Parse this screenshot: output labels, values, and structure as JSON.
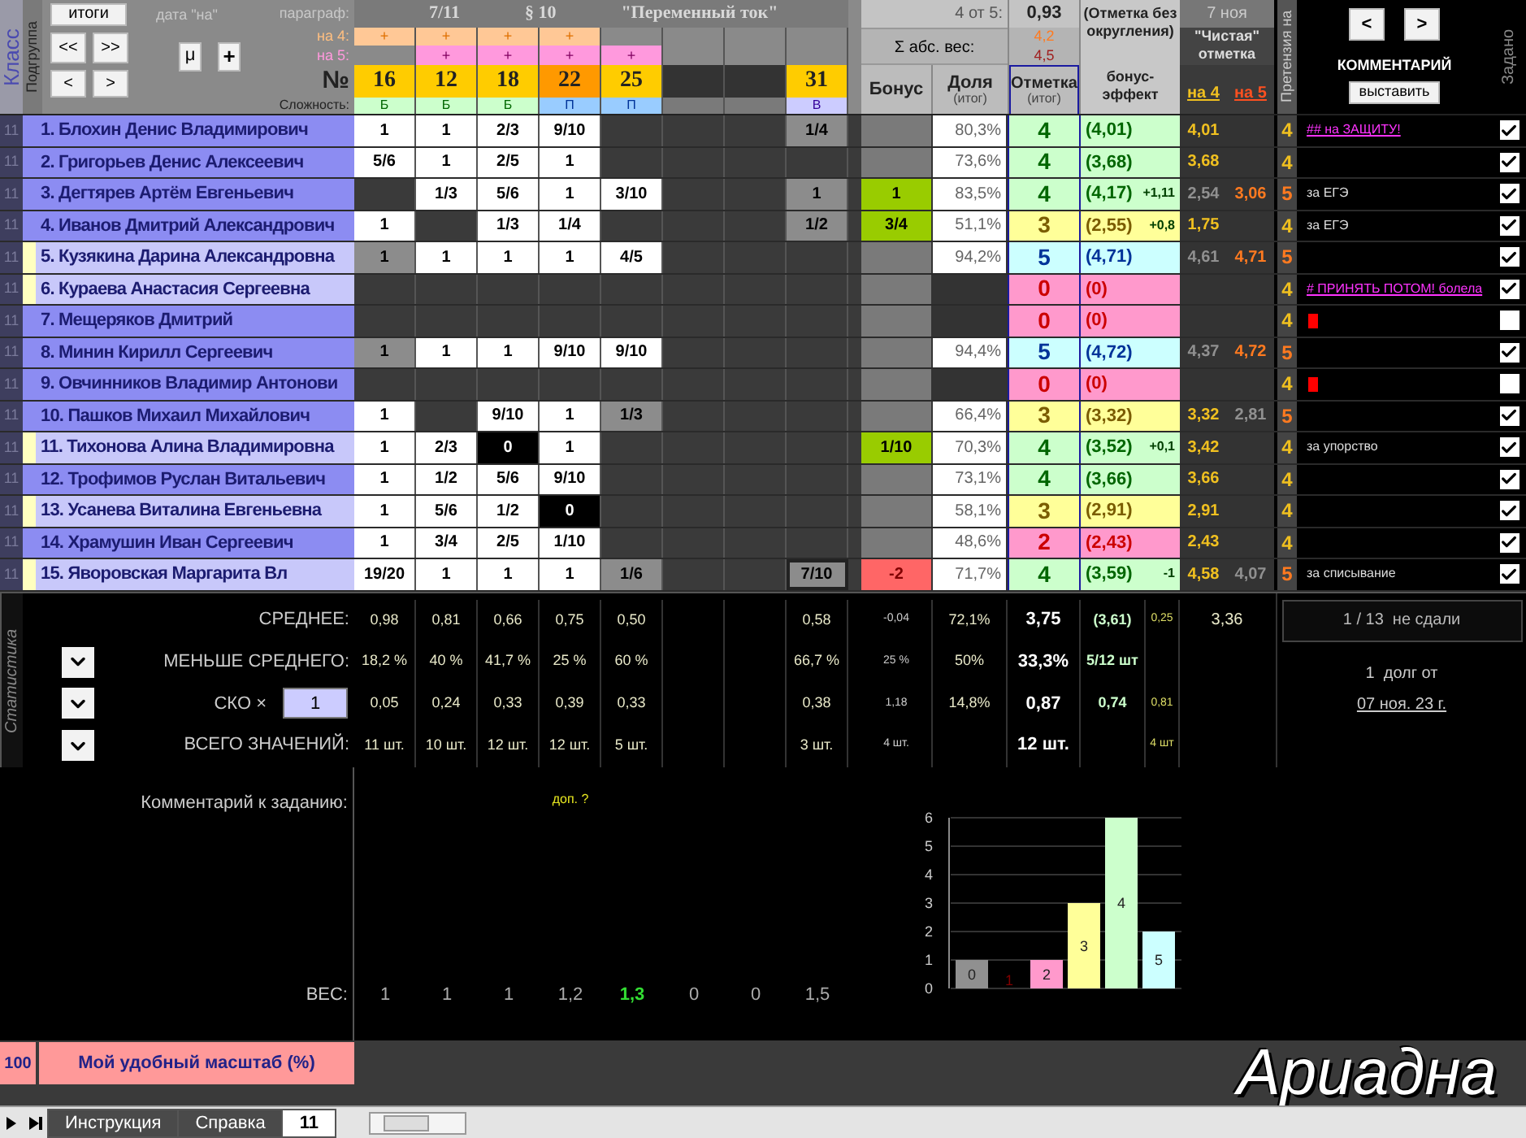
{
  "header": {
    "class_label": "Класс",
    "subgroup_label": "Подгруппа",
    "buttons": {
      "totals": "итоги",
      "first": "<<",
      "last": ">>",
      "prev": "<",
      "next": ">",
      "mu": "μ",
      "plus": "+"
    },
    "date_label": "дата \"на\"",
    "paragraph_label": "параграф:",
    "for4_label": "на 4:",
    "for5_label": "на 5:",
    "number_label": "№",
    "difficulty_label": "Сложность:",
    "lesson": "7/11",
    "paragraph": "§ 10",
    "topic": "\"Переменный ток\"",
    "tasks": [
      {
        "for4": "+",
        "number": "16",
        "highlighted": false,
        "difficulty": "Б",
        "kind": "basic"
      },
      {
        "for4": "+",
        "for5": "+",
        "number": "12",
        "highlighted": false,
        "difficulty": "Б",
        "kind": "basic"
      },
      {
        "for4": "+",
        "for5": "+",
        "number": "18",
        "highlighted": false,
        "difficulty": "Б",
        "kind": "basic"
      },
      {
        "for4": "+",
        "for5": "+",
        "number": "22",
        "highlighted": true,
        "difficulty": "П",
        "kind": "profile"
      },
      {
        "for5": "+",
        "number": "25",
        "highlighted": false,
        "difficulty": "П",
        "kind": "profile"
      },
      {
        "kind": "blank"
      },
      {
        "kind": "blank"
      },
      {
        "number": "31",
        "highlighted": false,
        "difficulty": "В",
        "kind": "advanced"
      }
    ],
    "four_of_five_label": "4 от 5:",
    "four_of_five": "0,93",
    "weight_sum_label": "Σ абс. вес:",
    "weight_for4": "4,2",
    "weight_for5": "4,5",
    "bonus_label": "Бонус",
    "share_label": "Доля",
    "share_sub": "(итог)",
    "mark_label": "Отметка",
    "mark_sub": "(итог)",
    "raw_label": "(Отметка без округления)",
    "raw_sub": "бонус-эффект",
    "date": "7 ноя",
    "clean_label": "\"Чистая\" отметка",
    "clean4_label": "на 4",
    "clean5_label": "на 5",
    "claim_label": "Претензия на",
    "comment_prev": "<",
    "comment_next": ">",
    "comment_label": "КОММЕНТАРИЙ",
    "post_button": "выставить",
    "assigned_label": "Задано"
  },
  "students": [
    {
      "class": "11",
      "girl": false,
      "name": "1. Блохин Денис Владимирович",
      "cells": [
        {
          "text": "1",
          "kind": "filled"
        },
        {
          "text": "1",
          "kind": "filled"
        },
        {
          "text": "2/3",
          "kind": "filled"
        },
        {
          "text": "9/10",
          "kind": "filled"
        },
        {
          "kind": "empty"
        },
        {
          "kind": "empty"
        },
        {
          "kind": "empty"
        },
        {
          "text": "1/4",
          "kind": "partial"
        }
      ],
      "bonus": {
        "kind": "none"
      },
      "share": "80,3%",
      "mark": {
        "text": "4",
        "kind": "good"
      },
      "raw": "(4,01)",
      "clean4": {
        "text": "4,01",
        "color": "#f0c020"
      },
      "claim": {
        "text": "4",
        "color": "#f0c020"
      },
      "comment": {
        "text": "## на ЗАЩИТУ!",
        "kind": "link"
      },
      "assigned": true
    },
    {
      "class": "11",
      "girl": false,
      "name": "2. Григорьев Денис Алексеевич",
      "cells": [
        {
          "text": "5/6",
          "kind": "filled"
        },
        {
          "text": "1",
          "kind": "filled"
        },
        {
          "text": "2/5",
          "kind": "filled"
        },
        {
          "text": "1",
          "kind": "filled"
        },
        {
          "kind": "empty"
        },
        {
          "kind": "empty"
        },
        {
          "kind": "empty"
        },
        {
          "kind": "empty"
        }
      ],
      "bonus": {
        "kind": "none"
      },
      "share": "73,6%",
      "mark": {
        "text": "4",
        "kind": "good"
      },
      "raw": "(3,68)",
      "clean4": {
        "text": "3,68",
        "color": "#f0c020"
      },
      "claim": {
        "text": "4",
        "color": "#f0c020"
      },
      "assigned": true
    },
    {
      "class": "11",
      "girl": false,
      "name": "3. Дегтярев Артём Евгеньевич",
      "cells": [
        {
          "kind": "empty"
        },
        {
          "text": "1/3",
          "kind": "filled"
        },
        {
          "text": "5/6",
          "kind": "filled"
        },
        {
          "text": "1",
          "kind": "filled"
        },
        {
          "text": "3/10",
          "kind": "filled"
        },
        {
          "kind": "empty"
        },
        {
          "kind": "empty"
        },
        {
          "text": "1",
          "kind": "partial"
        }
      ],
      "bonus": {
        "kind": "plus",
        "text": "1"
      },
      "share": "83,5%",
      "mark": {
        "text": "4",
        "kind": "good"
      },
      "raw": "(4,17)",
      "raw_extra": "+1,11",
      "clean4": {
        "text": "2,54",
        "color": "#909090"
      },
      "clean5": {
        "text": "3,06",
        "color": "#ff7a20"
      },
      "claim": {
        "text": "5",
        "color": "#ff7a20"
      },
      "comment": {
        "text": "за ЕГЭ",
        "kind": "note"
      },
      "assigned": true
    },
    {
      "class": "11",
      "girl": false,
      "name": "4. Иванов Дмитрий Александрович",
      "cells": [
        {
          "text": "1",
          "kind": "filled"
        },
        {
          "kind": "empty"
        },
        {
          "text": "1/3",
          "kind": "filled"
        },
        {
          "text": "1/4",
          "kind": "filled"
        },
        {
          "kind": "empty"
        },
        {
          "kind": "empty"
        },
        {
          "kind": "empty"
        },
        {
          "text": "1/2",
          "kind": "partial"
        }
      ],
      "bonus": {
        "kind": "plus",
        "text": "3/4"
      },
      "share": "51,1%",
      "mark": {
        "text": "3",
        "kind": "fair"
      },
      "raw": "(2,55)",
      "raw_extra": "+0,8",
      "clean4": {
        "text": "1,75",
        "color": "#f0c020"
      },
      "claim": {
        "text": "4",
        "color": "#f0c020"
      },
      "comment": {
        "text": "за ЕГЭ",
        "kind": "note"
      },
      "assigned": true
    },
    {
      "class": "11",
      "girl": true,
      "name": "5. Кузякина Дарина Александровна",
      "cells": [
        {
          "text": "1",
          "kind": "partial"
        },
        {
          "text": "1",
          "kind": "filled"
        },
        {
          "text": "1",
          "kind": "filled"
        },
        {
          "text": "1",
          "kind": "filled"
        },
        {
          "text": "4/5",
          "kind": "filled"
        },
        {
          "kind": "empty"
        },
        {
          "kind": "empty"
        },
        {
          "kind": "empty"
        }
      ],
      "bonus": {
        "kind": "none"
      },
      "share": "94,2%",
      "mark": {
        "text": "5",
        "kind": "excellent"
      },
      "raw": "(4,71)",
      "clean4": {
        "text": "4,61",
        "color": "#909090"
      },
      "clean5": {
        "text": "4,71",
        "color": "#ff7a20"
      },
      "claim": {
        "text": "5",
        "color": "#ff7a20"
      },
      "assigned": true
    },
    {
      "class": "11",
      "girl": true,
      "name": "6. Кураева Анастасия Сергеевна",
      "cells": [
        {
          "kind": "empty"
        },
        {
          "kind": "empty"
        },
        {
          "kind": "empty"
        },
        {
          "kind": "empty"
        },
        {
          "kind": "empty"
        },
        {
          "kind": "empty"
        },
        {
          "kind": "empty"
        },
        {
          "kind": "empty"
        }
      ],
      "bonus": {
        "kind": "none"
      },
      "mark": {
        "text": "0",
        "kind": "fail"
      },
      "raw": "(0)",
      "claim": {
        "text": "4",
        "color": "#f0c020"
      },
      "comment": {
        "text": "# ПРИНЯТЬ ПОТОМ! болела",
        "kind": "link"
      },
      "assigned": true
    },
    {
      "class": "11",
      "girl": false,
      "name": "7. Мещеряков Дмитрий",
      "cells": [
        {
          "kind": "empty"
        },
        {
          "kind": "empty"
        },
        {
          "kind": "empty"
        },
        {
          "kind": "empty"
        },
        {
          "kind": "empty"
        },
        {
          "kind": "empty"
        },
        {
          "kind": "empty"
        },
        {
          "kind": "empty"
        }
      ],
      "bonus": {
        "kind": "none"
      },
      "mark": {
        "text": "0",
        "kind": "fail"
      },
      "raw": "(0)",
      "claim": {
        "text": "4",
        "color": "#f0c020"
      },
      "comment": {
        "kind": "flag"
      },
      "assigned": false
    },
    {
      "class": "11",
      "girl": false,
      "name": "8. Минин Кирилл Сергеевич",
      "cells": [
        {
          "text": "1",
          "kind": "partial"
        },
        {
          "text": "1",
          "kind": "filled"
        },
        {
          "text": "1",
          "kind": "filled"
        },
        {
          "text": "9/10",
          "kind": "filled"
        },
        {
          "text": "9/10",
          "kind": "filled"
        },
        {
          "kind": "empty"
        },
        {
          "kind": "empty"
        },
        {
          "kind": "empty"
        }
      ],
      "bonus": {
        "kind": "none"
      },
      "share": "94,4%",
      "mark": {
        "text": "5",
        "kind": "excellent"
      },
      "raw": "(4,72)",
      "clean4": {
        "text": "4,37",
        "color": "#909090"
      },
      "clean5": {
        "text": "4,72",
        "color": "#ff7a20"
      },
      "claim": {
        "text": "5",
        "color": "#ff7a20"
      },
      "assigned": true
    },
    {
      "class": "11",
      "girl": false,
      "name": "9. Овчинников Владимир Антонови",
      "cells": [
        {
          "kind": "empty"
        },
        {
          "kind": "empty"
        },
        {
          "kind": "empty"
        },
        {
          "kind": "empty"
        },
        {
          "kind": "empty"
        },
        {
          "kind": "empty"
        },
        {
          "kind": "empty"
        },
        {
          "kind": "empty"
        }
      ],
      "bonus": {
        "kind": "none"
      },
      "mark": {
        "text": "0",
        "kind": "fail"
      },
      "raw": "(0)",
      "claim": {
        "text": "4",
        "color": "#f0c020"
      },
      "comment": {
        "kind": "flag"
      },
      "assigned": false
    },
    {
      "class": "11",
      "girl": false,
      "name": "10. Пашков Михаил Михайлович",
      "cells": [
        {
          "text": "1",
          "kind": "filled"
        },
        {
          "kind": "empty"
        },
        {
          "text": "9/10",
          "kind": "filled"
        },
        {
          "text": "1",
          "kind": "filled"
        },
        {
          "text": "1/3",
          "kind": "partial"
        },
        {
          "kind": "empty"
        },
        {
          "kind": "empty"
        },
        {
          "kind": "empty"
        }
      ],
      "bonus": {
        "kind": "none"
      },
      "share": "66,4%",
      "mark": {
        "text": "3",
        "kind": "fair"
      },
      "raw": "(3,32)",
      "clean4": {
        "text": "3,32",
        "color": "#f0c020"
      },
      "clean5": {
        "text": "2,81",
        "color": "#909090"
      },
      "claim": {
        "text": "5",
        "color": "#ff7a20"
      },
      "assigned": true
    },
    {
      "class": "11",
      "girl": true,
      "name": "11. Тихонова Алина Владимировна",
      "cells": [
        {
          "text": "1",
          "kind": "filled"
        },
        {
          "text": "2/3",
          "kind": "filled"
        },
        {
          "text": "0",
          "kind": "zero"
        },
        {
          "text": "1",
          "kind": "filled"
        },
        {
          "kind": "empty"
        },
        {
          "kind": "empty"
        },
        {
          "kind": "empty"
        },
        {
          "kind": "empty"
        }
      ],
      "bonus": {
        "kind": "plus",
        "text": "1/10"
      },
      "share": "70,3%",
      "mark": {
        "text": "4",
        "kind": "good"
      },
      "raw": "(3,52)",
      "raw_extra": "+0,1",
      "clean4": {
        "text": "3,42",
        "color": "#f0c020"
      },
      "claim": {
        "text": "4",
        "color": "#f0c020"
      },
      "comment": {
        "text": "за упорство",
        "kind": "note"
      },
      "assigned": true
    },
    {
      "class": "11",
      "girl": false,
      "name": "12. Трофимов Руслан Витальевич",
      "cells": [
        {
          "text": "1",
          "kind": "filled"
        },
        {
          "text": "1/2",
          "kind": "filled"
        },
        {
          "text": "5/6",
          "kind": "filled"
        },
        {
          "text": "9/10",
          "kind": "filled"
        },
        {
          "kind": "empty"
        },
        {
          "kind": "empty"
        },
        {
          "kind": "empty"
        },
        {
          "kind": "empty"
        }
      ],
      "bonus": {
        "kind": "none"
      },
      "share": "73,1%",
      "mark": {
        "text": "4",
        "kind": "good"
      },
      "raw": "(3,66)",
      "clean4": {
        "text": "3,66",
        "color": "#f0c020"
      },
      "claim": {
        "text": "4",
        "color": "#f0c020"
      },
      "assigned": true
    },
    {
      "class": "11",
      "girl": true,
      "name": "13. Усанева Виталина Евгеньевна",
      "cells": [
        {
          "text": "1",
          "kind": "filled"
        },
        {
          "text": "5/6",
          "kind": "filled"
        },
        {
          "text": "1/2",
          "kind": "filled"
        },
        {
          "text": "0",
          "kind": "zero"
        },
        {
          "kind": "empty"
        },
        {
          "kind": "empty"
        },
        {
          "kind": "empty"
        },
        {
          "kind": "empty"
        }
      ],
      "bonus": {
        "kind": "none"
      },
      "share": "58,1%",
      "mark": {
        "text": "3",
        "kind": "fair"
      },
      "raw": "(2,91)",
      "clean4": {
        "text": "2,91",
        "color": "#f0c020"
      },
      "claim": {
        "text": "4",
        "color": "#f0c020"
      },
      "assigned": true
    },
    {
      "class": "11",
      "girl": false,
      "name": "14. Храмушин Иван Сергеевич",
      "cells": [
        {
          "text": "1",
          "kind": "filled"
        },
        {
          "text": "3/4",
          "kind": "filled"
        },
        {
          "text": "2/5",
          "kind": "filled"
        },
        {
          "text": "1/10",
          "kind": "filled"
        },
        {
          "kind": "empty"
        },
        {
          "kind": "empty"
        },
        {
          "kind": "empty"
        },
        {
          "kind": "empty"
        }
      ],
      "bonus": {
        "kind": "none"
      },
      "share": "48,6%",
      "mark": {
        "text": "2",
        "kind": "fail"
      },
      "raw": "(2,43)",
      "clean4": {
        "text": "2,43",
        "color": "#f0c020"
      },
      "claim": {
        "text": "4",
        "color": "#f0c020"
      },
      "assigned": true
    },
    {
      "class": "11",
      "girl": true,
      "name": "15. Яворовская Маргарита Вл",
      "cells": [
        {
          "text": "19/20",
          "kind": "filled"
        },
        {
          "text": "1",
          "kind": "filled"
        },
        {
          "text": "1",
          "kind": "filled"
        },
        {
          "text": "1",
          "kind": "filled"
        },
        {
          "text": "1/6",
          "kind": "partial"
        },
        {
          "kind": "empty"
        },
        {
          "kind": "empty"
        },
        {
          "text": "7/10",
          "kind": "cursor"
        }
      ],
      "bonus": {
        "kind": "minus",
        "text": "-2"
      },
      "share": "71,7%",
      "mark": {
        "text": "4",
        "kind": "good"
      },
      "raw": "(3,59)",
      "raw_extra": "-1",
      "clean4": {
        "text": "4,58",
        "color": "#f0c020"
      },
      "clean5": {
        "text": "4,07",
        "color": "#909090"
      },
      "claim": {
        "text": "5",
        "color": "#ff7a20"
      },
      "comment": {
        "text": "за списывание",
        "kind": "note"
      },
      "assigned": true
    }
  ],
  "stats": {
    "title": "Статистика",
    "rows": [
      {
        "label": "СРЕДНЕЕ:",
        "kind": "plain",
        "values": [
          {
            "kind": "value",
            "text": "0,98"
          },
          {
            "kind": "value",
            "text": "0,81"
          },
          {
            "kind": "value",
            "text": "0,66"
          },
          {
            "kind": "value",
            "text": "0,75"
          },
          {
            "kind": "value",
            "text": "0,50"
          },
          {
            "kind": "blank"
          },
          {
            "kind": "blank"
          },
          {
            "kind": "value",
            "text": "0,58"
          },
          {
            "kind": "value",
            "text": "-0,04"
          },
          {
            "kind": "value",
            "text": "72,1%"
          },
          {
            "kind": "value",
            "text": "3,75"
          },
          {
            "kind": "value",
            "text": "(3,61)"
          },
          {
            "kind": "value",
            "text": "0,25"
          }
        ],
        "clean": "3,36"
      },
      {
        "label": "МЕНЬШЕ СРЕДНЕГО:",
        "kind": "dropdown",
        "values": [
          {
            "kind": "value",
            "text": "18,2 %"
          },
          {
            "kind": "value",
            "text": "40 %"
          },
          {
            "kind": "value",
            "text": "41,7 %"
          },
          {
            "kind": "value",
            "text": "25 %"
          },
          {
            "kind": "value",
            "text": "60 %"
          },
          {
            "kind": "blank"
          },
          {
            "kind": "blank"
          },
          {
            "kind": "value",
            "text": "66,7 %"
          },
          {
            "kind": "value",
            "text": "25 %"
          },
          {
            "kind": "value",
            "text": "50%"
          },
          {
            "kind": "value",
            "text": "33,3%"
          },
          {
            "kind": "value",
            "text": "5/12 шт"
          },
          {
            "kind": "blank"
          }
        ]
      },
      {
        "label": "СКО ×",
        "kind": "dropdown",
        "input": "1",
        "values": [
          {
            "kind": "value",
            "text": "0,05"
          },
          {
            "kind": "value",
            "text": "0,24"
          },
          {
            "kind": "value",
            "text": "0,33"
          },
          {
            "kind": "value",
            "text": "0,39"
          },
          {
            "kind": "value",
            "text": "0,33"
          },
          {
            "kind": "blank"
          },
          {
            "kind": "blank"
          },
          {
            "kind": "value",
            "text": "0,38"
          },
          {
            "kind": "value",
            "text": "1,18"
          },
          {
            "kind": "value",
            "text": "14,8%"
          },
          {
            "kind": "value",
            "text": "0,87"
          },
          {
            "kind": "value",
            "text": "0,74"
          },
          {
            "kind": "value",
            "text": "0,81"
          }
        ]
      },
      {
        "label": "ВСЕГО ЗНАЧЕНИЙ:",
        "kind": "dropdown",
        "values": [
          {
            "kind": "value",
            "text": "11 шт."
          },
          {
            "kind": "value",
            "text": "10 шт."
          },
          {
            "kind": "value",
            "text": "12 шт."
          },
          {
            "kind": "value",
            "text": "12 шт."
          },
          {
            "kind": "value",
            "text": "5 шт."
          },
          {
            "kind": "blank"
          },
          {
            "kind": "blank"
          },
          {
            "kind": "value",
            "text": "3 шт."
          },
          {
            "kind": "value",
            "text": "4 шт."
          },
          {
            "kind": "blank"
          },
          {
            "kind": "value",
            "text": "12 шт."
          },
          {
            "kind": "blank"
          },
          {
            "kind": "value",
            "text": "4 шт"
          }
        ]
      }
    ],
    "missing": "1 / 13  не сдали",
    "debt": "1  долг от",
    "debt_date": "07 ноя. 23 г."
  },
  "task_comment_label": "Комментарий к заданию:",
  "task_comments": [
    {
      "kind": "blank"
    },
    {
      "kind": "blank"
    },
    {
      "kind": "blank"
    },
    {
      "kind": "note",
      "text": "доп. ?"
    },
    {
      "kind": "blank"
    },
    {
      "kind": "blank"
    },
    {
      "kind": "blank"
    },
    {
      "kind": "blank"
    }
  ],
  "weights_label": "ВЕС:",
  "weights": [
    {
      "text": "1",
      "highlighted": false
    },
    {
      "text": "1",
      "highlighted": false
    },
    {
      "text": "1",
      "highlighted": false
    },
    {
      "text": "1,2",
      "highlighted": false
    },
    {
      "text": "1,3",
      "highlighted": true
    },
    {
      "text": "0",
      "highlighted": false
    },
    {
      "text": "0",
      "highlighted": false
    },
    {
      "text": "1,5",
      "highlighted": false
    }
  ],
  "chart_data": {
    "type": "bar",
    "categories": [
      "0",
      "1",
      "2",
      "3",
      "4",
      "5"
    ],
    "values": [
      1,
      0,
      1,
      3,
      6,
      2
    ],
    "colors": [
      "#909090",
      "#800000",
      "#ff99cc",
      "#ffff99",
      "#ccffcc",
      "#ccffff"
    ],
    "ylim": [
      0,
      6
    ],
    "yticks": [
      0,
      1,
      2,
      3,
      4,
      5,
      6
    ],
    "grid": true
  },
  "scale_value": "100",
  "scale_label": "Мой удобный масштаб (%)",
  "brand": "Ариадна",
  "tabs": [
    {
      "label": "Инструкция",
      "selected": false
    },
    {
      "label": "Справка",
      "selected": false
    },
    {
      "label": "11",
      "selected": true
    }
  ]
}
